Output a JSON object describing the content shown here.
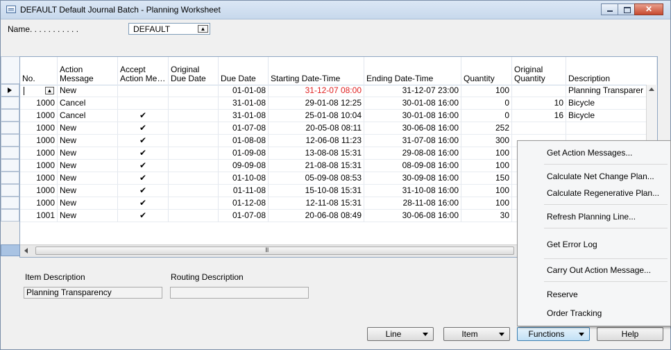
{
  "window": {
    "title": "DEFAULT Default Journal Batch - Planning Worksheet",
    "close_glyph": "✕"
  },
  "name_field": {
    "label": "Name. . . . . . . . . . .",
    "value": "DEFAULT",
    "lookup_glyph": "▲"
  },
  "grid": {
    "headers": {
      "no": "No.",
      "action": "Action Message",
      "accept": "Accept Action Me…",
      "orig_due": "Original Due Date",
      "due": "Due Date",
      "start": "Starting Date-Time",
      "end": "Ending Date-Time",
      "qty": "Quantity",
      "orig_qty": "Original Quantity",
      "desc": "Description"
    },
    "check_glyph": "✔",
    "lookup_glyph": "▲",
    "rows": [
      {
        "no": "",
        "action": "New",
        "accept": "",
        "orig_due": "",
        "due": "01-01-08",
        "start": "31-12-07 08:00",
        "end": "31-12-07 23:00",
        "qty": "100",
        "orig_qty": "",
        "desc": "Planning Transparer"
      },
      {
        "no": "1000",
        "action": "Cancel",
        "accept": "",
        "orig_due": "",
        "due": "31-01-08",
        "start": "29-01-08 12:25",
        "end": "30-01-08 16:00",
        "qty": "0",
        "orig_qty": "10",
        "desc": "Bicycle"
      },
      {
        "no": "1000",
        "action": "Cancel",
        "accept": "✔",
        "orig_due": "",
        "due": "31-01-08",
        "start": "25-01-08 10:04",
        "end": "30-01-08 16:00",
        "qty": "0",
        "orig_qty": "16",
        "desc": "Bicycle"
      },
      {
        "no": "1000",
        "action": "New",
        "accept": "✔",
        "orig_due": "",
        "due": "01-07-08",
        "start": "20-05-08 08:11",
        "end": "30-06-08 16:00",
        "qty": "252",
        "orig_qty": "",
        "desc": ""
      },
      {
        "no": "1000",
        "action": "New",
        "accept": "✔",
        "orig_due": "",
        "due": "01-08-08",
        "start": "12-06-08 11:23",
        "end": "31-07-08 16:00",
        "qty": "300",
        "orig_qty": "",
        "desc": ""
      },
      {
        "no": "1000",
        "action": "New",
        "accept": "✔",
        "orig_due": "",
        "due": "01-09-08",
        "start": "13-08-08 15:31",
        "end": "29-08-08 16:00",
        "qty": "100",
        "orig_qty": "",
        "desc": ""
      },
      {
        "no": "1000",
        "action": "New",
        "accept": "✔",
        "orig_due": "",
        "due": "09-09-08",
        "start": "21-08-08 15:31",
        "end": "08-09-08 16:00",
        "qty": "100",
        "orig_qty": "",
        "desc": ""
      },
      {
        "no": "1000",
        "action": "New",
        "accept": "✔",
        "orig_due": "",
        "due": "01-10-08",
        "start": "05-09-08 08:53",
        "end": "30-09-08 16:00",
        "qty": "150",
        "orig_qty": "",
        "desc": ""
      },
      {
        "no": "1000",
        "action": "New",
        "accept": "✔",
        "orig_due": "",
        "due": "01-11-08",
        "start": "15-10-08 15:31",
        "end": "31-10-08 16:00",
        "qty": "100",
        "orig_qty": "",
        "desc": ""
      },
      {
        "no": "1000",
        "action": "New",
        "accept": "✔",
        "orig_due": "",
        "due": "01-12-08",
        "start": "12-11-08 15:31",
        "end": "28-11-08 16:00",
        "qty": "100",
        "orig_qty": "",
        "desc": ""
      },
      {
        "no": "1001",
        "action": "New",
        "accept": "✔",
        "orig_due": "",
        "due": "01-07-08",
        "start": "20-06-08 08:49",
        "end": "30-06-08 16:00",
        "qty": "30",
        "orig_qty": "",
        "desc": ""
      }
    ]
  },
  "details": {
    "item_desc_label": "Item Description",
    "item_desc_value": "Planning Transparency",
    "routing_desc_label": "Routing Description",
    "routing_desc_value": ""
  },
  "buttons": {
    "line": "Line",
    "item": "Item",
    "functions": "Functions",
    "help": "Help"
  },
  "menu": {
    "items": [
      "Get Action Messages...",
      "Calculate Net Change Plan...",
      "Calculate Regenerative Plan...",
      "Refresh Planning Line...",
      "Get Error Log",
      "Carry Out Action Message...",
      "Reserve",
      "Order Tracking"
    ]
  },
  "colors": {
    "red_text": "#e02020",
    "title_gradient": "#c7d8ec"
  }
}
